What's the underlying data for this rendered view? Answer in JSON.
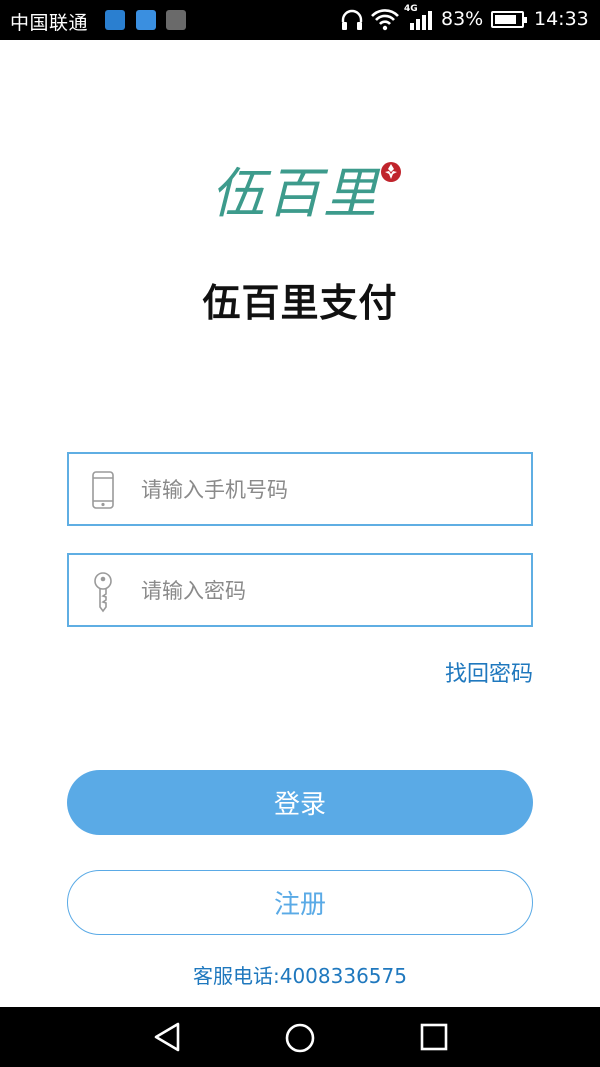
{
  "status_bar": {
    "carrier": "中国联通",
    "network": "4G",
    "battery_percent_text": "83%",
    "battery_level": 0.83,
    "time": "14:33"
  },
  "brand": {
    "logo_text": "伍百里",
    "title": "伍百里支付",
    "seal_color": "#c0242c",
    "logo_color": "#3d9b8c"
  },
  "login_form": {
    "phone_placeholder": "请输入手机号码",
    "phone_value": "",
    "password_placeholder": "请输入密码",
    "password_value": "",
    "forgot_password_label": "找回密码",
    "login_label": "登录",
    "register_label": "注册"
  },
  "footer": {
    "hotline": "客服电话:4008336575"
  },
  "icons": {
    "phone_field_icon": "smartphone-icon",
    "password_field_icon": "key-icon",
    "nav_back": "back-triangle-icon",
    "nav_home": "home-circle-icon",
    "nav_recents": "recents-square-icon"
  },
  "colors": {
    "accent": "#5aaae6",
    "link": "#1f78be",
    "input_border": "#5faee3"
  }
}
